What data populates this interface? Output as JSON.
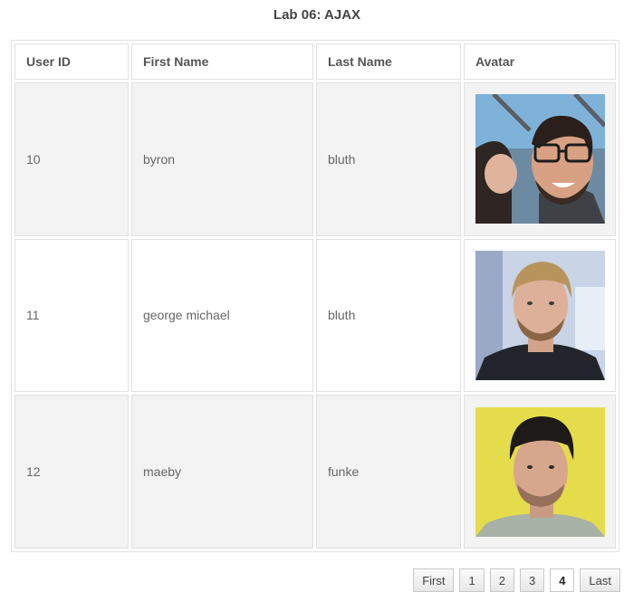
{
  "title": "Lab 06: AJAX",
  "table": {
    "headers": [
      "User ID",
      "First Name",
      "Last Name",
      "Avatar"
    ],
    "rows": [
      {
        "id": "10",
        "first": "byron",
        "last": "bluth",
        "avatar": "photo of smiling man with glasses being kissed"
      },
      {
        "id": "11",
        "first": "george michael",
        "last": "bluth",
        "avatar": "photo of blond man with beard"
      },
      {
        "id": "12",
        "first": "maeby",
        "last": "funke",
        "avatar": "photo of dark-haired man on yellow background"
      }
    ]
  },
  "pager": {
    "first": "First",
    "pages": [
      "1",
      "2",
      "3",
      "4"
    ],
    "current": "4",
    "last": "Last"
  }
}
